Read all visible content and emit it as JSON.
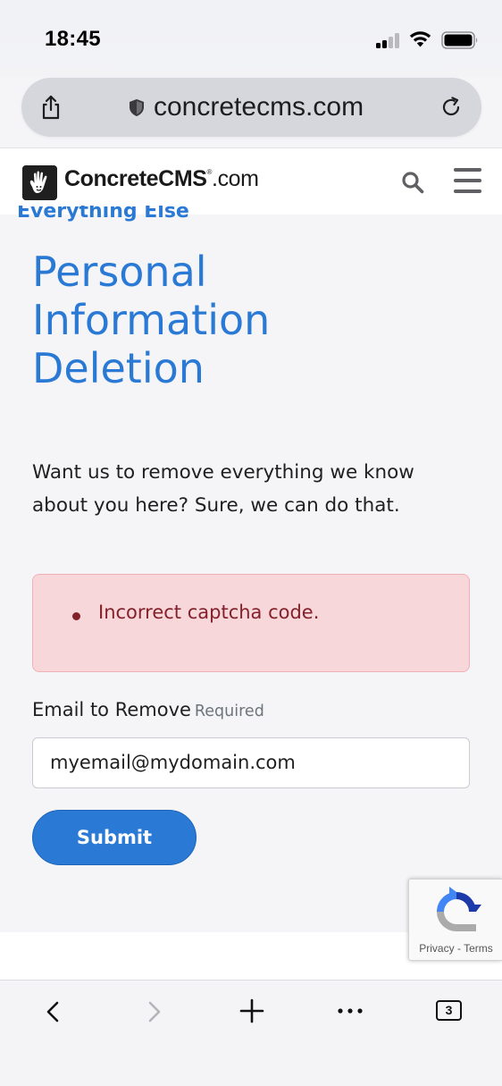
{
  "status_bar": {
    "time": "18:45"
  },
  "browser": {
    "url": "concretecms.com",
    "tab_count": "3"
  },
  "site_header": {
    "logo_bold": "ConcreteCMS",
    "logo_reg": "®",
    "logo_suffix": ".com"
  },
  "breadcrumb": {
    "partial_label": "Everything Else"
  },
  "main": {
    "title": "Personal Information Deletion",
    "intro": "Want us to remove everything we know about you here? Sure, we can do that.",
    "error_message": "Incorrect captcha code.",
    "email_label": "Email to Remove",
    "email_required": "Required",
    "email_value": "myemail@mydomain.com",
    "submit_label": "Submit"
  },
  "recaptcha": {
    "privacy": "Privacy",
    "separator": " - ",
    "terms": "Terms"
  },
  "colors": {
    "accent": "#2a7ad5",
    "error_bg": "#f8d7da",
    "error_text": "#842029"
  },
  "icons": {
    "status": [
      "signal-icon",
      "wifi-icon",
      "battery-icon"
    ],
    "address_bar": [
      "share-icon",
      "shield-icon",
      "reload-icon"
    ],
    "header": [
      "search-icon",
      "menu-icon"
    ],
    "toolbar": [
      "back-icon",
      "forward-icon",
      "new-tab-icon",
      "more-icon",
      "tabs-icon"
    ]
  }
}
